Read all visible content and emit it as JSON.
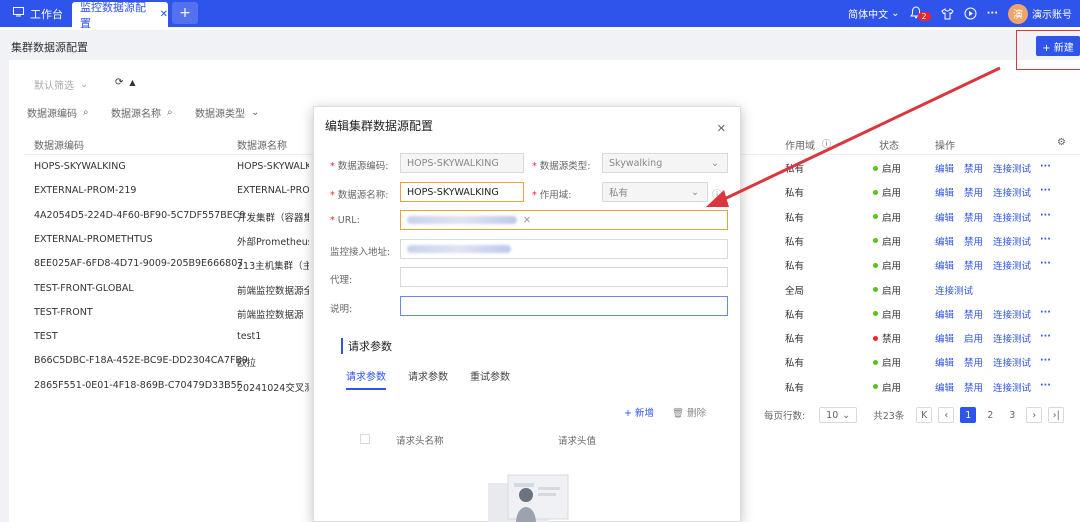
{
  "topbar": {
    "home_tab": "工作台",
    "active_tab": "监控数据源配置",
    "language": "简体中文",
    "notification_count": "2",
    "avatar_char": "演",
    "user_name": "演示账号",
    "accent_color": "#2f54eb"
  },
  "page": {
    "title": "集群数据源配置",
    "new_button": "+ 新建"
  },
  "filters": {
    "default_filter": "默认筛选",
    "fields": [
      "数据源编码",
      "数据源名称",
      "数据源类型"
    ]
  },
  "table": {
    "headers": [
      "数据源编码",
      "数据源名称",
      "作用域",
      "状态",
      "操作"
    ],
    "rows": [
      {
        "code": "HOPS-SKYWALKING",
        "name": "HOPS-SKYWALKING",
        "scope": "私有",
        "status": "启用",
        "ops": [
          "编辑",
          "禁用",
          "连接测试"
        ]
      },
      {
        "code": "EXTERNAL-PROM-219",
        "name": "EXTERNAL-PROM",
        "scope": "私有",
        "status": "启用",
        "ops": [
          "编辑",
          "禁用",
          "连接测试"
        ]
      },
      {
        "code": "4A2054D5-224D-4F60-BF90-5C7DF557BEC9",
        "name": "开发集群（容器集群",
        "scope": "私有",
        "status": "启用",
        "ops": [
          "编辑",
          "禁用",
          "连接测试"
        ]
      },
      {
        "code": "EXTERNAL-PROMETHTUS",
        "name": "外部Prometheus数",
        "scope": "私有",
        "status": "启用",
        "ops": [
          "编辑",
          "禁用",
          "连接测试"
        ]
      },
      {
        "code": "8EE025AF-6FD8-4D71-9009-205B9E666807",
        "name": "213主机集群（主机",
        "scope": "私有",
        "status": "启用",
        "ops": [
          "编辑",
          "禁用",
          "连接测试"
        ]
      },
      {
        "code": "TEST-FRONT-GLOBAL",
        "name": "前端监控数据源全局",
        "scope": "全局",
        "status": "启用",
        "ops": [
          "连接测试"
        ]
      },
      {
        "code": "TEST-FRONT",
        "name": "前端监控数据源",
        "scope": "私有",
        "status": "启用",
        "ops": [
          "编辑",
          "禁用",
          "连接测试"
        ]
      },
      {
        "code": "TEST",
        "name": "test1",
        "scope": "私有",
        "status": "禁用",
        "ops": [
          "编辑",
          "启用",
          "连接测试"
        ]
      },
      {
        "code": "B66C5DBC-F18A-452E-BC9E-DD2304CA7FB9",
        "name": "欧拉",
        "scope": "私有",
        "status": "启用",
        "ops": [
          "编辑",
          "禁用",
          "连接测试"
        ]
      },
      {
        "code": "2865F551-0E01-4F18-869B-C70479D33B5F",
        "name": "20241024交叉测试",
        "scope": "私有",
        "status": "启用",
        "ops": [
          "编辑",
          "禁用",
          "连接测试"
        ]
      }
    ]
  },
  "pager": {
    "page_size_label": "每页行数:",
    "page_size": "10",
    "total": "共23条",
    "pages": [
      "1",
      "2",
      "3"
    ],
    "current": "1"
  },
  "modal": {
    "title": "编辑集群数据源配置",
    "labels": {
      "code": "数据源编码:",
      "type": "数据源类型:",
      "name": "数据源名称:",
      "scope": "作用域:",
      "url": "URL:",
      "monitor_addr": "监控接入地址:",
      "proxy": "代理:",
      "desc": "说明:"
    },
    "values": {
      "code": "HOPS-SKYWALKING",
      "type": "Skywalking",
      "name": "HOPS-SKYWALKING",
      "scope": "私有"
    },
    "section_title": "请求参数",
    "subtabs": [
      "请求参数",
      "请求参数",
      "重试参数"
    ],
    "add": "+ 新增",
    "delete": "删除",
    "col_name": "请求头名称",
    "col_value": "请求头值"
  }
}
